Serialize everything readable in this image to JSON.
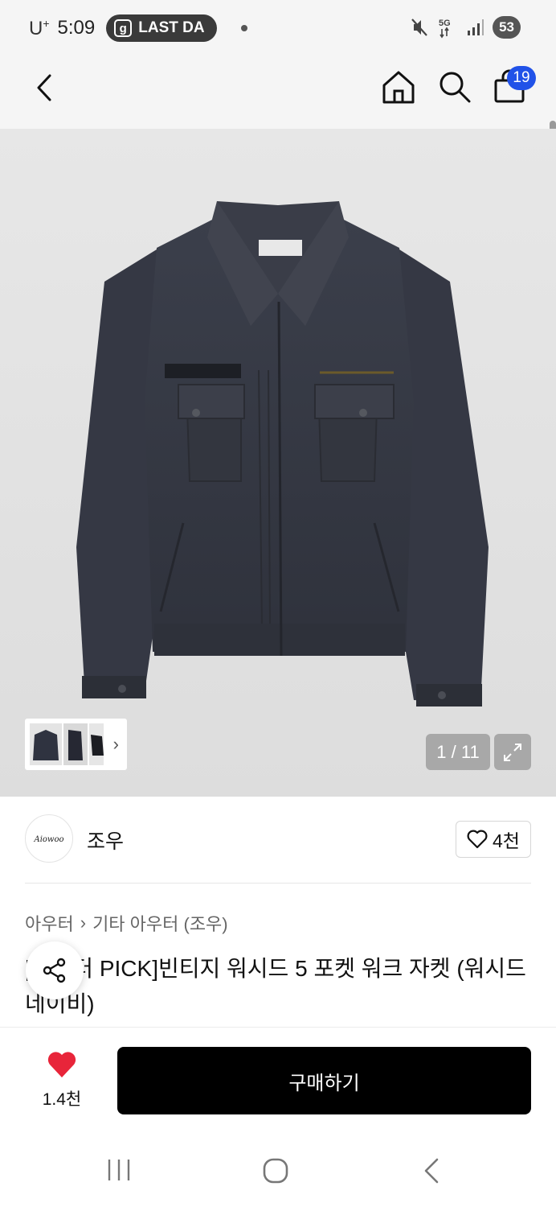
{
  "status_bar": {
    "carrier": "U",
    "carrier_sup": "+",
    "time": "5:09",
    "notification": "LAST DA",
    "notification_icon": "g",
    "network": "5G",
    "battery": "53"
  },
  "header": {
    "back_icon": "chevron-left-icon",
    "home_icon": "home-icon",
    "search_icon": "search-icon",
    "bag_icon": "shopping-bag-icon",
    "bag_count": "19"
  },
  "gallery": {
    "counter": "1 / 11",
    "thumbs_arrow": "›",
    "background": "#e2e2e2"
  },
  "brand": {
    "name": "조우",
    "logo_text": "Aiowoo",
    "likes": "4천"
  },
  "breadcrumb": {
    "level1": "아우터",
    "separator": "›",
    "level2": "기타 아우터 (조우)"
  },
  "product": {
    "title": "[에디터 PICK]빈티지 워시드 5 포켓 워크 자켓 (워시드 네이비)"
  },
  "bottom": {
    "wish_count": "1.4천",
    "buy_label": "구매하기",
    "heart_color": "#e8253a",
    "buy_color": "#000000"
  },
  "system_nav": {
    "recent_icon": "recent-apps-icon",
    "home_icon": "home-circle-icon",
    "back_icon": "back-icon"
  }
}
